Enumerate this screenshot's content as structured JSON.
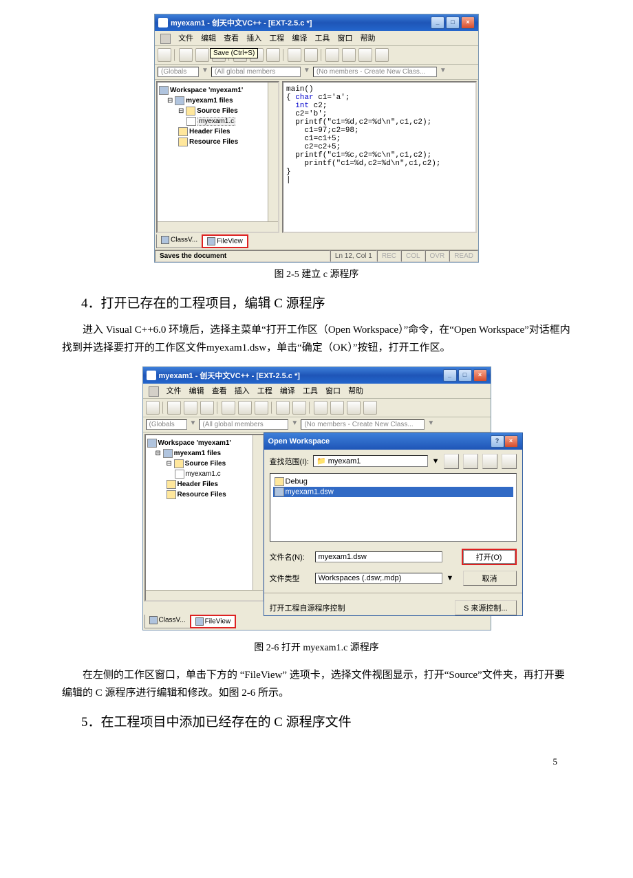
{
  "app": {
    "title": "myexam1 - 创天中文VC++ - [EXT-2.5.c *]",
    "menu": {
      "file": "文件",
      "edit": "编辑",
      "view": "查看",
      "insert": "插入",
      "project": "工程",
      "build": "编译",
      "tools": "工具",
      "window": "窗口",
      "help": "帮助"
    },
    "tooltip": "Save (Ctrl+S)",
    "combos": {
      "c1": "(Globals",
      "c2": "(All global members",
      "c3": "(No members - Create New Class...",
      "arrow": "▼"
    }
  },
  "tree": {
    "workspace": "Workspace 'myexam1'",
    "files": "myexam1 files",
    "source": "Source Files",
    "srcfile": "myexam1.c",
    "header": "Header Files",
    "resource": "Resource Files"
  },
  "tabs": {
    "class": "ClassV...",
    "file": "FileView"
  },
  "code": {
    "l1": "main()",
    "l2": "{ char c1='a';",
    "l2kw": "char",
    "l3": "  int c2;",
    "l3kw": "int",
    "l4": "  c2='b';",
    "l5": "  printf(\"c1=%d,c2=%d\\n\",c1,c2);",
    "l6": "    c1=97;c2=98;",
    "l7": "    c1=c1+5;",
    "l8": "    c2=c2+5;",
    "l9": "  printf(\"c1=%c,c2=%c\\n\",c1,c2);",
    "l10": "    printf(\"c1=%d,c2=%d\\n\",c1,c2);",
    "l11": "}",
    "l12": "|"
  },
  "status": {
    "main": "Saves the document",
    "pos": "Ln 12, Col 1",
    "rec": "REC",
    "col": "COL",
    "ovr": "OVR",
    "read": "READ"
  },
  "caption1": "图 2-5   建立 c 源程序",
  "h4": "4．打开已存在的工程项目，编辑 C 源程序",
  "p1": "进入 Visual C++6.0 环境后，选择主菜单“打开工作区（Open   Workspace）”命令，在“Open   Workspace”对话框内找到并选择要打开的工作区文件myexam1.dsw，单击“确定（OK）”按钮，打开工作区。",
  "dialog": {
    "title": "Open Workspace",
    "look": "查找范围(I):",
    "lookval": "myexam1",
    "items": {
      "debug": "Debug",
      "dsw": "myexam1.dsw"
    },
    "name": "文件名(N):",
    "nameval": "myexam1.dsw",
    "type": "文件类型",
    "typeval": "Workspaces (.dsw;.mdp)",
    "open": "打开(O)",
    "cancel": "取消",
    "foot1": "打开工程自源程序控制",
    "foot2": "S 来源控制..."
  },
  "caption2": "图 2-6   打开 myexam1.c 源程序",
  "p2": "在左侧的工作区窗口，单击下方的 “FileView” 选项卡，选择文件视图显示，打开“Source”文件夹，再打开要编辑的 C 源程序进行编辑和修改。如图 2-6 所示。",
  "h5": "5．在工程项目中添加已经存在的 C 源程序文件",
  "pagenum": "5"
}
